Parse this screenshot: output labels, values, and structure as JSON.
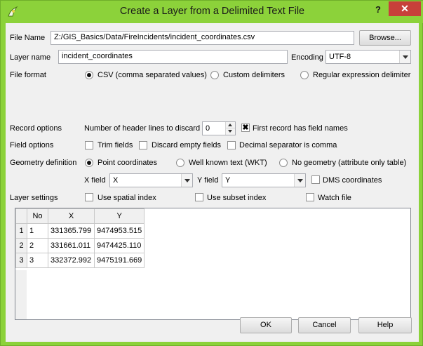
{
  "window": {
    "title": "Create a Layer from a Delimited Text File",
    "help_label": "?",
    "close_label": "✕"
  },
  "file": {
    "label": "File Name",
    "value": "Z:/GIS_Basics/Data/FireIncidents/incident_coordinates.csv",
    "browse_label": "Browse..."
  },
  "layer": {
    "label": "Layer name",
    "value": "incident_coordinates",
    "encoding_label": "Encoding",
    "encoding_value": "UTF-8"
  },
  "file_format": {
    "label": "File format",
    "options": [
      {
        "label": "CSV (comma separated values)",
        "selected": true
      },
      {
        "label": "Custom delimiters",
        "selected": false
      },
      {
        "label": "Regular expression delimiter",
        "selected": false
      }
    ]
  },
  "record_options": {
    "label": "Record options",
    "header_lines_label": "Number of header lines to discard",
    "header_lines_value": "0",
    "first_record_label": "First record has field names",
    "first_record_checked": true
  },
  "field_options": {
    "label": "Field options",
    "trim_label": "Trim fields",
    "discard_empty_label": "Discard empty fields",
    "decimal_sep_label": "Decimal separator is comma"
  },
  "geometry": {
    "label": "Geometry definition",
    "options": [
      {
        "label": "Point coordinates",
        "selected": true
      },
      {
        "label": "Well known text (WKT)",
        "selected": false
      },
      {
        "label": "No geometry (attribute only table)",
        "selected": false
      }
    ],
    "x_field_label": "X field",
    "x_field_value": "X",
    "y_field_label": "Y field",
    "y_field_value": "Y",
    "dms_label": "DMS coordinates"
  },
  "layer_settings": {
    "label": "Layer settings",
    "spatial_index_label": "Use spatial index",
    "subset_index_label": "Use subset index",
    "watch_file_label": "Watch file"
  },
  "preview": {
    "columns": [
      "No",
      "X",
      "Y"
    ],
    "rows": [
      {
        "row": "1",
        "cells": [
          "1",
          "331365.799",
          "9474953.515"
        ]
      },
      {
        "row": "2",
        "cells": [
          "2",
          "331661.011",
          "9474425.110"
        ]
      },
      {
        "row": "3",
        "cells": [
          "3",
          "332372.992",
          "9475191.669"
        ]
      }
    ]
  },
  "buttons": {
    "ok": "OK",
    "cancel": "Cancel",
    "help": "Help"
  },
  "colors": {
    "title_bar": "#8cd23a",
    "close_button": "#c7403a",
    "dialog_background": "#f0f0f0"
  }
}
